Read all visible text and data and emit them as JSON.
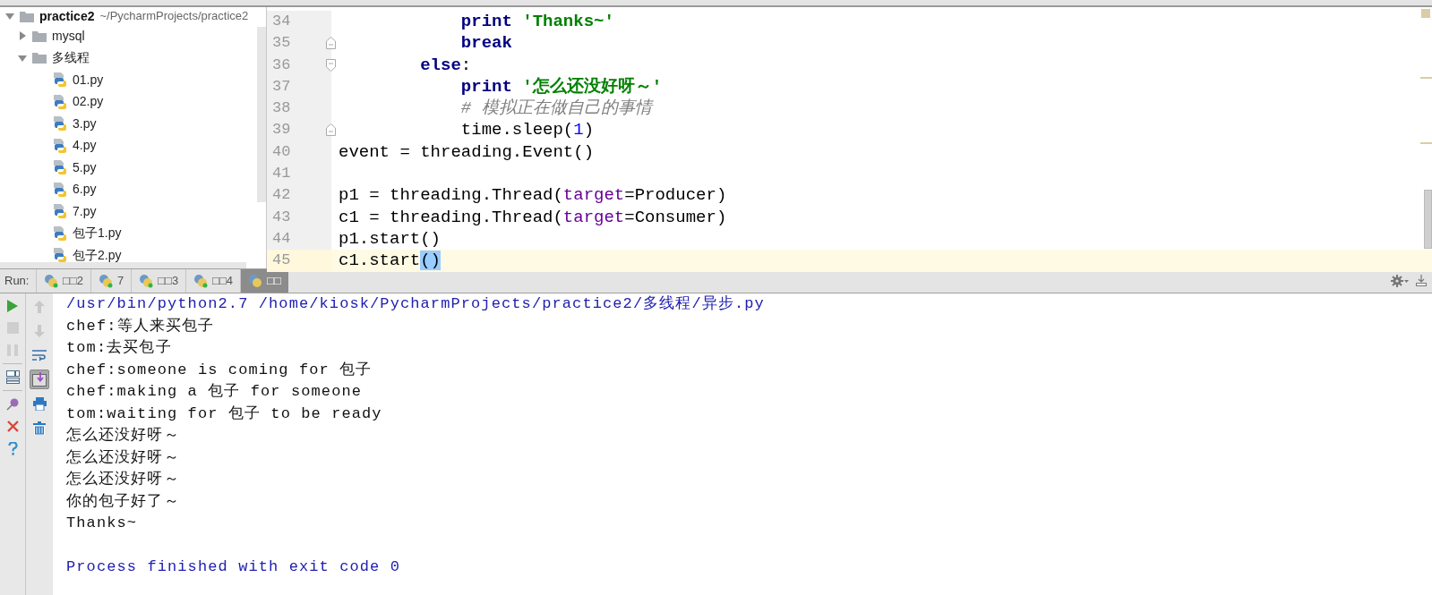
{
  "project_tree": {
    "root": {
      "name": "practice2",
      "path": "~/PycharmProjects/practice2",
      "expanded": true,
      "children": [
        {
          "name": "mysql",
          "kind": "folder",
          "expanded": false
        },
        {
          "name": "多线程",
          "kind": "folder",
          "expanded": true,
          "children": [
            {
              "name": "01.py",
              "kind": "python"
            },
            {
              "name": "02.py",
              "kind": "python"
            },
            {
              "name": "3.py",
              "kind": "python"
            },
            {
              "name": "4.py",
              "kind": "python"
            },
            {
              "name": "5.py",
              "kind": "python"
            },
            {
              "name": "6.py",
              "kind": "python"
            },
            {
              "name": "7.py",
              "kind": "python"
            },
            {
              "name": "包子1.py",
              "kind": "python"
            },
            {
              "name": "包子2.py",
              "kind": "python"
            }
          ]
        }
      ]
    }
  },
  "editor": {
    "lines": [
      {
        "number": "34",
        "tokens": [
          {
            "text": "            print",
            "kind": "keyword"
          },
          {
            "text": " 'Thanks~'",
            "kind": "string"
          }
        ]
      },
      {
        "number": "35",
        "fold": {
          "kind": "end"
        },
        "tokens": [
          {
            "text": "            break",
            "kind": "keyword"
          }
        ]
      },
      {
        "number": "36",
        "fold": {
          "kind": "start"
        },
        "tokens": [
          {
            "text": "        else",
            "kind": "keyword"
          },
          {
            "text": ":"
          }
        ]
      },
      {
        "number": "37",
        "tokens": [
          {
            "text": "            print",
            "kind": "keyword"
          },
          {
            "text": " '怎么还没好呀～'",
            "kind": "string"
          }
        ]
      },
      {
        "number": "38",
        "tokens": [
          {
            "text": "            # 模拟正在做自己的事情",
            "kind": "comment"
          }
        ]
      },
      {
        "number": "39",
        "fold": {
          "kind": "end"
        },
        "tokens": [
          {
            "text": "            time.sleep("
          },
          {
            "text": "1",
            "kind": "number"
          },
          {
            "text": ")"
          }
        ]
      },
      {
        "number": "40",
        "tokens": [
          {
            "text": "event = threading.Event()"
          }
        ]
      },
      {
        "number": "41"
      },
      {
        "number": "42",
        "tokens": [
          {
            "text": "p1 = threading.Thread("
          },
          {
            "text": "target",
            "kind": "param"
          },
          {
            "text": "=Producer)"
          }
        ]
      },
      {
        "number": "43",
        "tokens": [
          {
            "text": "c1 = threading.Thread("
          },
          {
            "text": "target",
            "kind": "param"
          },
          {
            "text": "=Consumer)"
          }
        ]
      },
      {
        "number": "44",
        "tokens": [
          {
            "text": "p1.start()"
          }
        ]
      },
      {
        "number": "45",
        "current": true,
        "tokens": [
          {
            "text": "c1.start"
          },
          {
            "text": "()",
            "kind": "match"
          }
        ]
      }
    ]
  },
  "run_panel": {
    "label": "Run:",
    "tabs": [
      {
        "label": "□□2",
        "selected": false
      },
      {
        "label": "7",
        "selected": false
      },
      {
        "label": "□□3",
        "selected": false
      },
      {
        "label": "□□4",
        "selected": false
      },
      {
        "label": "□□",
        "selected": true
      }
    ],
    "toolbar_left": [
      {
        "kind": "run",
        "disabled": false
      },
      {
        "kind": "stop",
        "disabled": true
      },
      {
        "kind": "pause",
        "disabled": true
      },
      {
        "kind": "layout",
        "disabled": false
      },
      {
        "kind": "pin",
        "disabled": false
      },
      {
        "kind": "close",
        "disabled": false
      },
      {
        "kind": "help",
        "disabled": false
      }
    ],
    "toolbar_right": [
      {
        "kind": "up",
        "on": false
      },
      {
        "kind": "down",
        "on": false
      },
      {
        "kind": "wrap",
        "on": false
      },
      {
        "kind": "scroll-end",
        "on": true
      },
      {
        "kind": "print",
        "on": false
      },
      {
        "kind": "trash",
        "on": false
      }
    ],
    "console": [
      {
        "kind": "command",
        "text": "/usr/bin/python2.7 /home/kiosk/PycharmProjects/practice2/多线程/异步.py"
      },
      {
        "kind": "output",
        "text": "chef:等人来买包子"
      },
      {
        "kind": "output",
        "text": "tom:去买包子"
      },
      {
        "kind": "output",
        "text": "chef:someone is coming for 包子"
      },
      {
        "kind": "output",
        "text": "chef:making a 包子 for someone"
      },
      {
        "kind": "output",
        "text": "tom:waiting for 包子 to be ready"
      },
      {
        "kind": "output",
        "text": "怎么还没好呀～"
      },
      {
        "kind": "output",
        "text": "怎么还没好呀～"
      },
      {
        "kind": "output",
        "text": "怎么还没好呀～"
      },
      {
        "kind": "output",
        "text": "你的包子好了～"
      },
      {
        "kind": "output",
        "text": "Thanks~"
      },
      {
        "kind": "blank"
      },
      {
        "kind": "exit",
        "text": "Process finished with exit code 0"
      }
    ]
  }
}
